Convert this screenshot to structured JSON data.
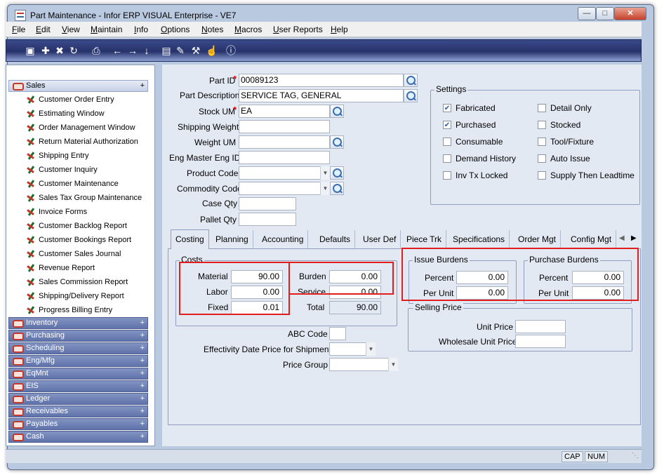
{
  "window": {
    "title": "Part Maintenance - Infor ERP VISUAL Enterprise - VE7"
  },
  "menu": [
    "File",
    "Edit",
    "View",
    "Maintain",
    "Info",
    "Options",
    "Notes",
    "Macros",
    "User Reports",
    "Help"
  ],
  "toolbar_icons": [
    "save-icon",
    "new-icon",
    "delete-icon",
    "refresh-icon",
    "print-icon",
    "arrow-left-icon",
    "arrow-right-icon",
    "arrow-down-icon",
    "document-icon",
    "notes-icon",
    "tools-icon",
    "hand-icon",
    "info-icon"
  ],
  "sidebar": {
    "open_group": "Sales",
    "sales_items": [
      "Customer Order Entry",
      "Estimating Window",
      "Order Management Window",
      "Return Material Authorization",
      "Shipping Entry",
      "Customer Inquiry",
      "Customer Maintenance",
      "Sales Tax Group Maintenance",
      "Invoice Forms",
      "Customer Backlog Report",
      "Customer Bookings Report",
      "Customer Sales Journal",
      "Revenue Report",
      "Sales Commission Report",
      "Shipping/Delivery Report",
      "Progress Billing Entry"
    ],
    "other_groups": [
      "Inventory",
      "Purchasing",
      "Scheduling",
      "Eng/Mfg",
      "EqMnt",
      "EIS",
      "Ledger",
      "Receivables",
      "Payables",
      "Cash"
    ],
    "toggle_open": "+",
    "toggle_closed": "+"
  },
  "form": {
    "part_id_label": "Part ID",
    "part_id": "00089123",
    "description_label": "Part Description",
    "description": "SERVICE TAG, GENERAL",
    "stock_um_label": "Stock UM",
    "stock_um": "EA",
    "shipping_weight_label": "Shipping Weight",
    "shipping_weight": "",
    "weight_um_label": "Weight UM",
    "weight_um": "",
    "eng_master_label": "Eng Master Eng ID",
    "eng_master": "",
    "product_code_label": "Product Code",
    "product_code": "",
    "commodity_code_label": "Commodity Code",
    "commodity_code": "",
    "case_qty_label": "Case Qty",
    "case_qty": "",
    "pallet_qty_label": "Pallet Qty",
    "pallet_qty": ""
  },
  "settings": {
    "title": "Settings",
    "items": [
      {
        "label": "Fabricated",
        "checked": true
      },
      {
        "label": "Detail Only",
        "checked": false
      },
      {
        "label": "Purchased",
        "checked": true
      },
      {
        "label": "Stocked",
        "checked": false
      },
      {
        "label": "Consumable",
        "checked": false
      },
      {
        "label": "Tool/Fixture",
        "checked": false
      },
      {
        "label": "Demand History",
        "checked": false
      },
      {
        "label": "Auto Issue",
        "checked": false
      },
      {
        "label": "Inv Tx Locked",
        "checked": false
      },
      {
        "label": "Supply Then Leadtime",
        "checked": false
      }
    ]
  },
  "tabs": [
    "Costing",
    "Planning",
    "Accounting",
    "Defaults",
    "User Def",
    "Piece Trk",
    "Specifications",
    "Order Mgt",
    "Config Mgt"
  ],
  "active_tab": "Costing",
  "tab_nav": {
    "prev": "◀",
    "next": "▶"
  },
  "costing": {
    "costs_title": "Costs",
    "material_label": "Material",
    "material": "90.00",
    "labor_label": "Labor",
    "labor": "0.00",
    "fixed_label": "Fixed",
    "fixed": "0.01",
    "burden_label": "Burden",
    "burden": "0.00",
    "service_label": "Service",
    "service": "0.00",
    "total_label": "Total",
    "total": "90.00",
    "issue_burdens_title": "Issue Burdens",
    "issue_percent_label": "Percent",
    "issue_percent": "0.00",
    "issue_per_unit_label": "Per Unit",
    "issue_per_unit": "0.00",
    "purchase_burdens_title": "Purchase Burdens",
    "purchase_percent_label": "Percent",
    "purchase_percent": "0.00",
    "purchase_per_unit_label": "Per Unit",
    "purchase_per_unit": "0.00",
    "selling_price_title": "Selling Price",
    "unit_price_label": "Unit Price",
    "unit_price": "",
    "wholesale_label": "Wholesale Unit Price",
    "wholesale": "",
    "abc_code_label": "ABC Code",
    "abc_code": "",
    "effectivity_label": "Effectivity  Date Price for Shipments",
    "effectivity": "",
    "price_group_label": "Price Group",
    "price_group": ""
  },
  "status": {
    "cap": "CAP",
    "num": "NUM"
  },
  "colors": {
    "highlight": "#e11d1d",
    "required": "#d40000"
  }
}
